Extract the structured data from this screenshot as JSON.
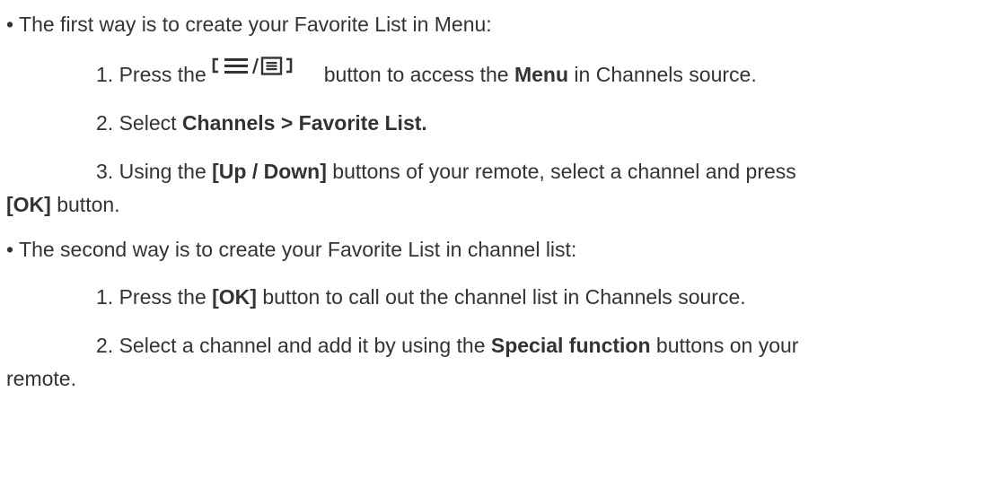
{
  "section1": {
    "bullet": "• ",
    "intro": "The first way is to create your Favorite List in Menu:",
    "steps": [
      {
        "num": "1. ",
        "pre": "Press the",
        "post": "button to access the ",
        "bold": "Menu",
        "tail": " in Channels source.",
        "icon": "menu-button-icon"
      },
      {
        "num": "2. ",
        "pre": "Select ",
        "bold": "Channels > Favorite List."
      },
      {
        "num": "3. ",
        "pre": "Using the ",
        "bold": "[Up / Down]",
        "mid": " buttons of your remote, select a channel and press",
        "bold2": "[OK]",
        "tail": " button."
      }
    ]
  },
  "section2": {
    "bullet": "• ",
    "intro": "The second way is to create your Favorite List in channel list:",
    "steps": [
      {
        "num": "1. ",
        "pre": "Press the ",
        "bold": "[OK]",
        "tail": " button to call out the channel list in Channels source."
      },
      {
        "num": "2. ",
        "pre": "Select a channel and add it by using the ",
        "bold": "Special function",
        "mid": " buttons on your",
        "tail": "remote."
      }
    ]
  }
}
